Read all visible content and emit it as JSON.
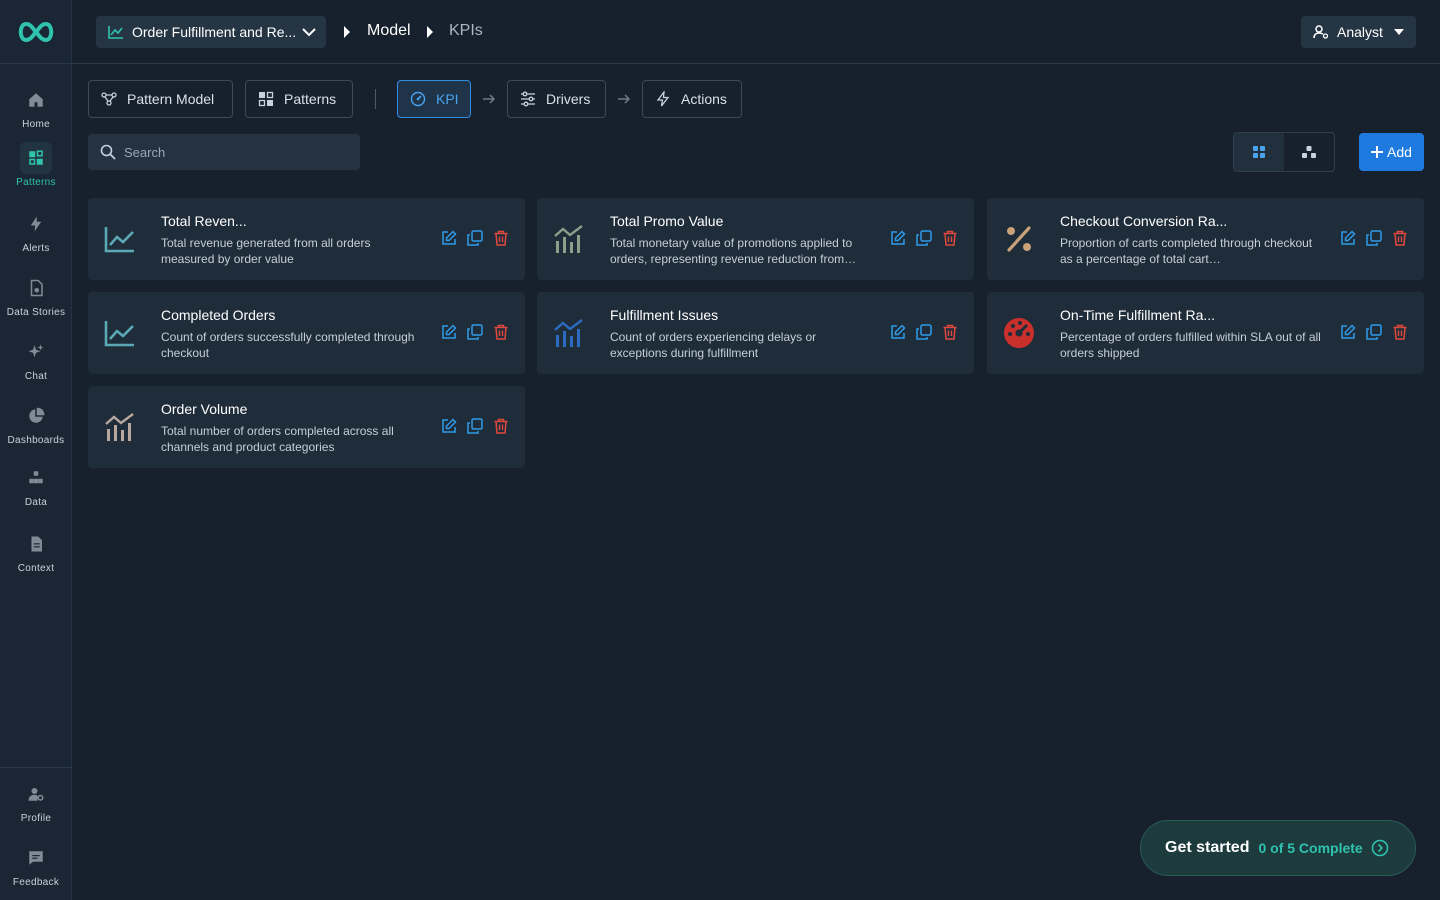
{
  "sidebar": {
    "items": [
      {
        "label": "Home",
        "icon": "home-icon"
      },
      {
        "label": "Patterns",
        "icon": "patterns-icon",
        "active": true
      },
      {
        "label": "Alerts",
        "icon": "lightning-icon"
      },
      {
        "label": "Data Stories",
        "icon": "data-stories-icon"
      },
      {
        "label": "Chat",
        "icon": "sparkle-icon"
      },
      {
        "label": "Dashboards",
        "icon": "pie-icon"
      },
      {
        "label": "Data",
        "icon": "data-icon"
      },
      {
        "label": "Context",
        "icon": "document-icon"
      }
    ],
    "bottom": [
      {
        "label": "Profile",
        "icon": "profile-icon"
      },
      {
        "label": "Feedback",
        "icon": "feedback-icon"
      }
    ]
  },
  "topbar": {
    "project": "Order Fulfillment and Re...",
    "breadcrumb": [
      "Model",
      "KPIs"
    ],
    "role": "Analyst"
  },
  "steps": {
    "pattern_model": "Pattern Model",
    "patterns": "Patterns",
    "kpi": "KPI",
    "drivers": "Drivers",
    "actions": "Actions"
  },
  "search": {
    "placeholder": "Search",
    "value": ""
  },
  "add_label": "Add",
  "colors": {
    "accent": "#2fc3ad",
    "primary": "#1f7ae0",
    "danger": "#e0483e",
    "edit": "#2f9be8"
  },
  "kpis": [
    {
      "title": "Total Reven...",
      "description": "Total revenue generated from all orders measured by order value",
      "icon": "line-trend-icon",
      "icon_color": "#5aa9b5"
    },
    {
      "title": "Total Promo Value",
      "description": "Total monetary value of promotions applied to orders, representing revenue reduction from…",
      "icon": "bar-trend-icon",
      "icon_color": "#8aa08a"
    },
    {
      "title": "Checkout Conversion Ra...",
      "description": "Proportion of carts completed through checkout as a percentage of total cart…",
      "icon": "percent-icon",
      "icon_color": "#c9a27a"
    },
    {
      "title": "Completed Orders",
      "description": "Count of orders successfully completed through checkout",
      "icon": "line-trend-icon",
      "icon_color": "#5aa9b5"
    },
    {
      "title": "Fulfillment Issues",
      "description": "Count of orders experiencing delays or exceptions during fulfillment",
      "icon": "bar-trend-icon",
      "icon_color": "#2b6cc0"
    },
    {
      "title": "On-Time Fulfillment Ra...",
      "description": "Percentage of orders fulfilled within SLA out of all orders shipped",
      "icon": "gauge-icon",
      "icon_color": "#c9302c"
    },
    {
      "title": "Order Volume",
      "description": "Total number of orders completed across all channels and product categories",
      "icon": "bar-trend-icon",
      "icon_color": "#b8a89e"
    }
  ],
  "get_started": {
    "title": "Get started",
    "progress": "0 of 5 Complete"
  }
}
